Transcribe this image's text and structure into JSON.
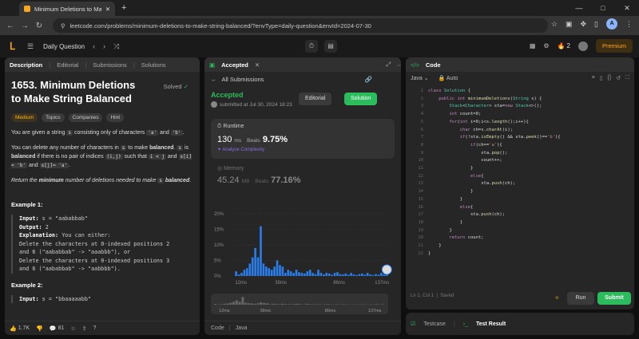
{
  "browser": {
    "tab_title": "Minimum Deletions to Make S",
    "url": "leetcode.com/problems/minimum-deletions-to-make-string-balanced/?envType=daily-question&envId=2024-07-30",
    "profile_initial": "A"
  },
  "nav": {
    "daily_label": "Daily Question",
    "streak": "2",
    "premium_label": "Premium"
  },
  "left": {
    "tabs": [
      "Description",
      "Editorial",
      "Submissions",
      "Solutions"
    ],
    "title": "1653. Minimum Deletions to Make String Balanced",
    "solved_label": "Solved",
    "chips": [
      "Medium",
      "Topics",
      "Companies",
      "Hint"
    ],
    "p1a": "You are given a string ",
    "p1s": "s",
    "p1b": " consisting only of characters ",
    "p1c": "'a'",
    "p1d": " and ",
    "p1e": "'b'",
    "p2a": "You can delete any number of characters in ",
    "p2b": " to make ",
    "p2c": "balanced",
    "p2d": " is ",
    "p2e": " if there is no pair of indices ",
    "p2f": "(i,j)",
    "p2g": " such that ",
    "p2h": "i < j",
    "p2i": " and ",
    "p2j": "s[i] = 'b'",
    "p2k": "s[j]= 'a'",
    "p3a": "Return the ",
    "p3b": "minimum",
    "p3c": " number of deletions needed to make ",
    "ex1_title": "Example 1:",
    "ex1_input_lbl": "Input:",
    "ex1_input": " s = \"aababbab\"",
    "ex1_output_lbl": "Output:",
    "ex1_output": " 2",
    "ex1_expl_lbl": "Explanation:",
    "ex1_expl": " You can either:",
    "ex1_l1": "Delete the characters at 0-indexed positions 2",
    "ex1_l2": "and 6 (\"aababbab\" -> \"aaabbb\"), or",
    "ex1_l3": "Delete the characters at 0-indexed positions 3",
    "ex1_l4": "and 6 (\"aababbab\" -> \"aabbbb\").",
    "ex2_title": "Example 2:",
    "ex2_input_lbl": "Input:",
    "ex2_input": " s = \"bbaaaaabb\"",
    "likes": "1.7K",
    "comments": "81"
  },
  "mid": {
    "tab": "Accepted",
    "back_label": "All Submissions",
    "status": "Accepted",
    "submitted_by": "submitted at Jul 30, 2024 18:23",
    "editorial_btn": "Editorial",
    "solution_btn": "Solution",
    "runtime_label": "Runtime",
    "runtime_value": "130",
    "runtime_unit": "ms",
    "beats_label": "Beats",
    "runtime_beats": "9.75%",
    "analyze_label": "Analyze Complexity",
    "memory_label": "Memory",
    "memory_value": "45.24",
    "memory_unit": "MB",
    "memory_beats": "77.16%",
    "footer_code": "Code",
    "footer_lang": "Java"
  },
  "chart_data": {
    "type": "bar",
    "ylim": [
      0,
      20
    ],
    "yticks": [
      "20%",
      "15%",
      "10%",
      "5%",
      "0%"
    ],
    "xticks": [
      "12ms",
      "38ms",
      "86ms",
      "137ms"
    ],
    "minimap_ticks": [
      "12ms",
      "38ms",
      "86ms",
      "137ms"
    ],
    "values": [
      1.5,
      0.5,
      1,
      2,
      2.5,
      4,
      6,
      9,
      6,
      16,
      4,
      3,
      2.5,
      2,
      3,
      5,
      3.5,
      3,
      1,
      2,
      1.5,
      1,
      2,
      1.2,
      1,
      0.8,
      1.5,
      2,
      1,
      0.6,
      2,
      1,
      0.5,
      1,
      0.8,
      0.4,
      1,
      1.2,
      0.6,
      0.5,
      0.8,
      0.4,
      1,
      0.5,
      0.3,
      0.6,
      0.8,
      0.4,
      1,
      0.5,
      0.3,
      0.6,
      0.4,
      1,
      0.5,
      0.8
    ],
    "highlight_index": 55
  },
  "right": {
    "tab": "Code",
    "lang": "Java",
    "mode": "Auto",
    "status": "Ln 1, Col 1",
    "saved": "Saved",
    "run_label": "Run",
    "submit_label": "Submit",
    "code_lines": [
      "class Solution {",
      "    public int minimumDeletions(String s) {",
      "        Stack<Character> sta=new Stack<>();",
      "        int count=0;",
      "        for(int i=0;i<s.length();i++){",
      "            char ch=s.charAt(i);",
      "            if(!sta.isEmpty() && sta.peek()=='b'){",
      "                if(ch=='a'){",
      "                    sta.pop();",
      "                    count++;",
      "                }",
      "                else{",
      "                    sta.push(ch);",
      "                }",
      "            }",
      "            else{",
      "                sta.push(ch);",
      "            }",
      "        }",
      "        return count;",
      "    }",
      "}"
    ]
  },
  "console": {
    "testcase": "Testcase",
    "result": "Test Result"
  }
}
